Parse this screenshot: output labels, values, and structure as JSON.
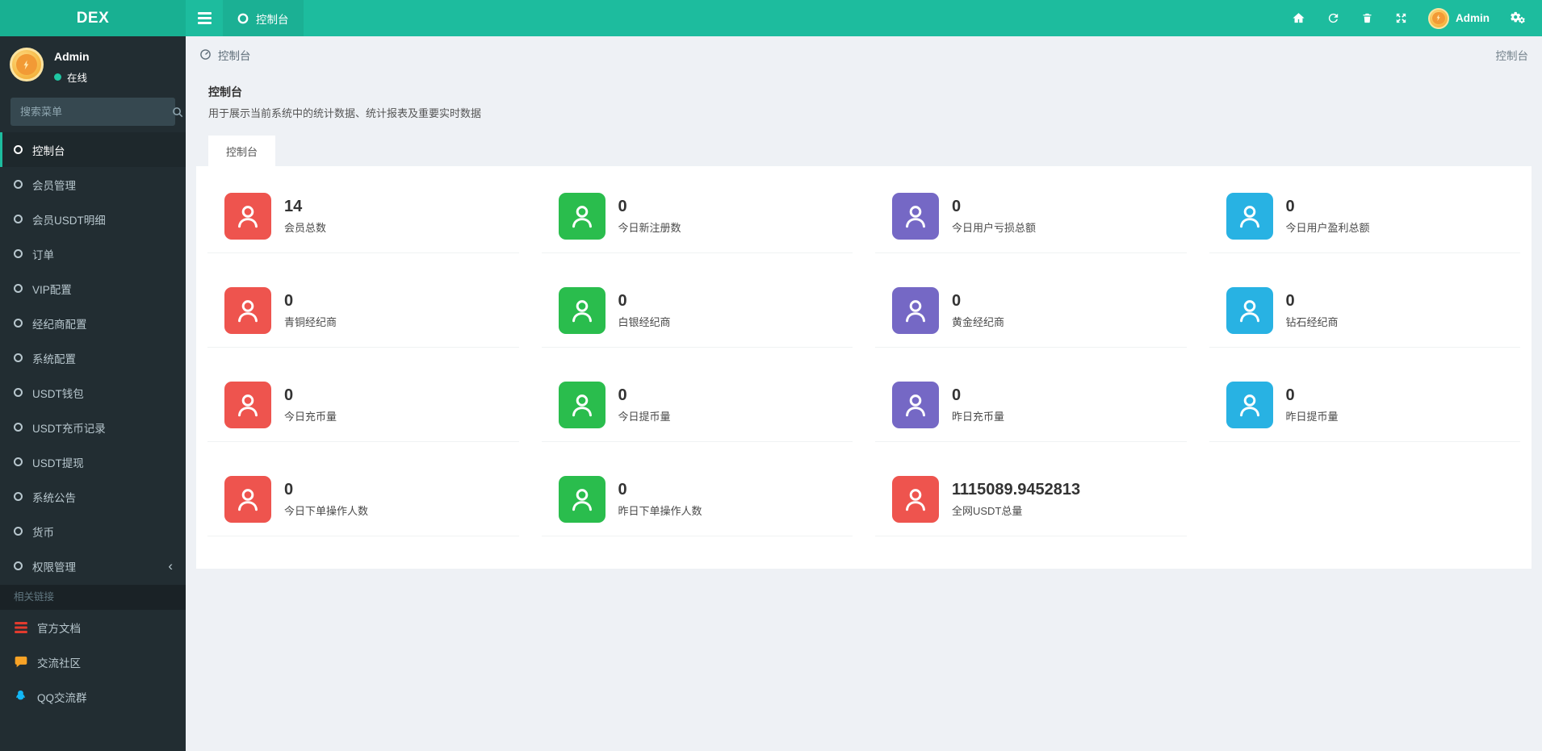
{
  "topbar": {
    "brand": "DEX",
    "tab_label": "控制台",
    "user_name": "Admin"
  },
  "sidebar": {
    "user": {
      "name": "Admin",
      "status": "在线"
    },
    "search_placeholder": "搜索菜单",
    "menu": [
      {
        "id": "console",
        "label": "控制台",
        "active": true
      },
      {
        "id": "members",
        "label": "会员管理"
      },
      {
        "id": "member-usdt-detail",
        "label": "会员USDT明细"
      },
      {
        "id": "orders",
        "label": "订单"
      },
      {
        "id": "vip-config",
        "label": "VIP配置"
      },
      {
        "id": "broker-config",
        "label": "经纪商配置"
      },
      {
        "id": "system-config",
        "label": "系统配置"
      },
      {
        "id": "usdt-wallet",
        "label": "USDT钱包"
      },
      {
        "id": "usdt-deposit-records",
        "label": "USDT充币记录"
      },
      {
        "id": "usdt-withdraw",
        "label": "USDT提现"
      },
      {
        "id": "announcements",
        "label": "系统公告"
      },
      {
        "id": "currency",
        "label": "货币"
      },
      {
        "id": "permissions",
        "label": "权限管理",
        "has_children": true
      }
    ],
    "section_label": "相关链接",
    "links": [
      {
        "label": "官方文档",
        "icon": "doc-list-icon",
        "color": "#e23b2e"
      },
      {
        "label": "交流社区",
        "icon": "comment-icon",
        "color": "#f8a326"
      },
      {
        "label": "QQ交流群",
        "icon": "qq-penguin-icon",
        "color": "#12b7f5"
      }
    ]
  },
  "breadcrumb": {
    "label": "控制台",
    "right_label": "控制台"
  },
  "panel": {
    "title": "控制台",
    "description": "用于展示当前系统中的统计数据、统计报表及重要实时数据",
    "tab_label": "控制台"
  },
  "colors": {
    "topbar": "#1dbc9e",
    "sidebar": "#222d32",
    "red": "#ee544e",
    "green": "#2abd4d",
    "purple": "#7568c5",
    "cyan": "#28b2e3"
  },
  "stats": [
    {
      "id": "total-members",
      "value": "14",
      "label": "会员总数",
      "color": "red"
    },
    {
      "id": "today-new-registrations",
      "value": "0",
      "label": "今日新注册数",
      "color": "green"
    },
    {
      "id": "today-user-loss",
      "value": "0",
      "label": "今日用户亏损总额",
      "color": "purple"
    },
    {
      "id": "today-user-profit",
      "value": "0",
      "label": "今日用户盈利总额",
      "color": "cyan"
    },
    {
      "id": "bronze-brokers",
      "value": "0",
      "label": "青铜经纪商",
      "color": "red"
    },
    {
      "id": "silver-brokers",
      "value": "0",
      "label": "白银经纪商",
      "color": "green"
    },
    {
      "id": "gold-brokers",
      "value": "0",
      "label": "黄金经纪商",
      "color": "purple"
    },
    {
      "id": "diamond-brokers",
      "value": "0",
      "label": "钻石经纪商",
      "color": "cyan"
    },
    {
      "id": "today-deposit-volume",
      "value": "0",
      "label": "今日充币量",
      "color": "red"
    },
    {
      "id": "today-withdraw-volume",
      "value": "0",
      "label": "今日提币量",
      "color": "green"
    },
    {
      "id": "yesterday-deposit-volume",
      "value": "0",
      "label": "昨日充币量",
      "color": "purple"
    },
    {
      "id": "yesterday-withdraw-volume",
      "value": "0",
      "label": "昨日提币量",
      "color": "cyan"
    },
    {
      "id": "today-order-users",
      "value": "0",
      "label": "今日下单操作人数",
      "color": "red"
    },
    {
      "id": "yesterday-order-users",
      "value": "0",
      "label": "昨日下单操作人数",
      "color": "green"
    },
    {
      "id": "network-usdt-total",
      "value": "1115089.9452813",
      "label": "全网USDT总量",
      "color": "red"
    }
  ]
}
